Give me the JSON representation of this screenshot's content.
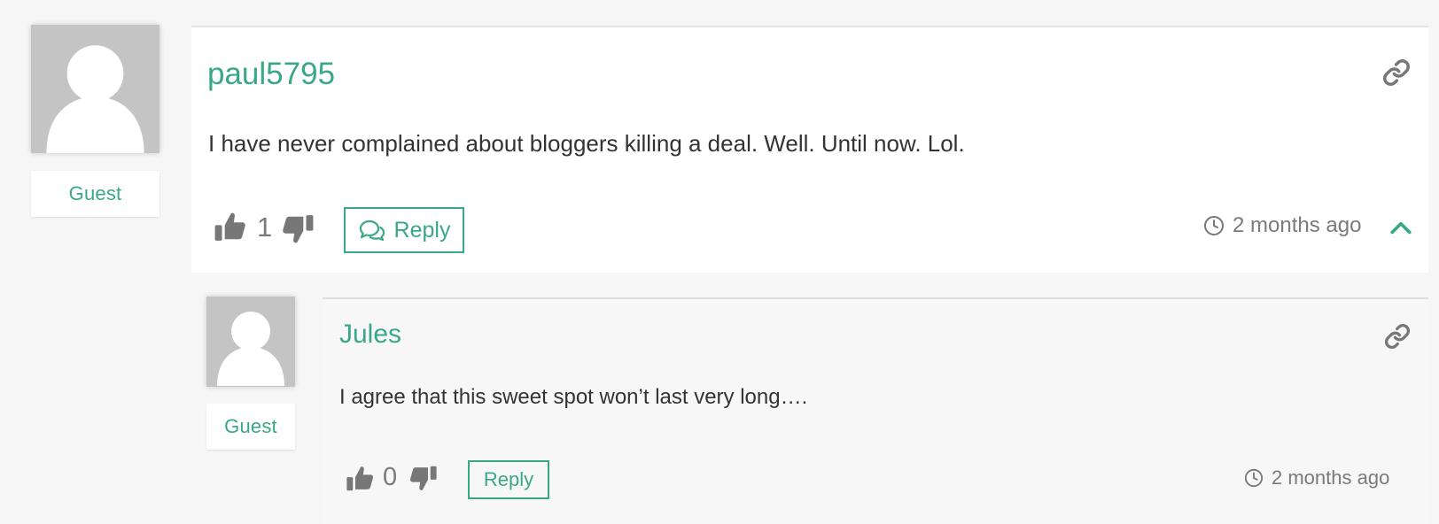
{
  "comments": [
    {
      "author": "paul5795",
      "role": "Guest",
      "text": "I have never complained about bloggers killing a deal. Well. Until now. Lol.",
      "votes": "1",
      "reply_label": "Reply",
      "timestamp": "2 months ago"
    },
    {
      "author": "Jules",
      "role": "Guest",
      "text": "I agree that this sweet spot won’t last very long….",
      "votes": "0",
      "reply_label": "Reply",
      "timestamp": "2 months ago"
    }
  ],
  "icons": {
    "permalink": "link-icon",
    "like": "thumbs-up-icon",
    "dislike": "thumbs-down-icon",
    "reply": "chat-bubbles-icon",
    "time": "clock-icon",
    "collapse": "chevron-up-icon"
  },
  "colors": {
    "accent": "#3aa888",
    "page_background": "#f6f6f6",
    "card_background": "#ffffff",
    "reply_background": "#f7f7f7",
    "avatar_background": "#c4c4c4",
    "icon_gray": "#777777"
  }
}
